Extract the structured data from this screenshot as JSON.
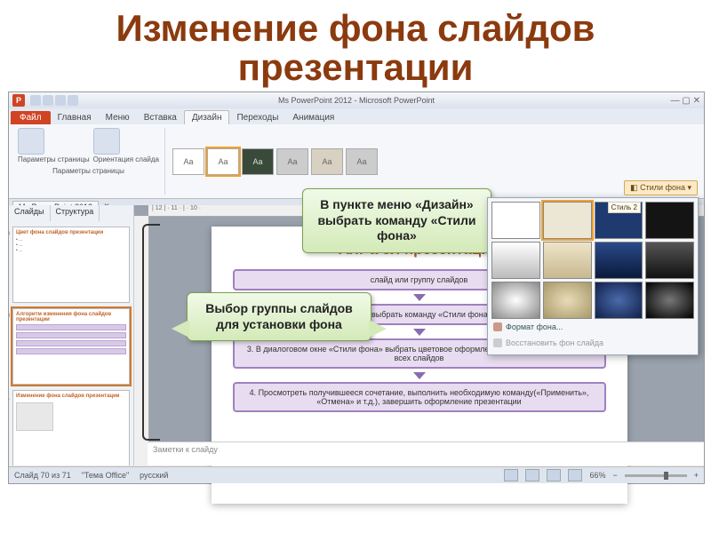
{
  "slide_title": "Изменение фона слайдов презентации",
  "titlebar": {
    "doc": "Ms PowerPoint 2012 - Microsoft PowerPoint"
  },
  "tabs": {
    "file": "Файл",
    "list": [
      "Главная",
      "Меню",
      "Вставка",
      "Дизайн",
      "Переходы",
      "Анимация"
    ],
    "active": "Дизайн"
  },
  "ribbon": {
    "page_setup": "Параметры\nстраницы",
    "orientation": "Ориентация\nслайда",
    "group_label": "Параметры страницы",
    "theme_glyph": "Aa"
  },
  "doc_tab": "Ms PowerPoint 2012",
  "side_tabs": [
    "Слайды",
    "Структура"
  ],
  "thumbs": [
    {
      "num": "69",
      "title": "Цвет фона слайдов презентации"
    },
    {
      "num": "70",
      "title": "Алгоритм изменения фона слайдов презентации"
    },
    {
      "num": "71",
      "title": "Изменение фона слайдов презентации"
    }
  ],
  "ruler": "| 12 | · 11 · | · 10 ·",
  "page": {
    "heading_partial": "Алг                                    а сл         презентации",
    "step1": "слайд или группу слайдов",
    "step2": "Дизайн» выбрать команду «Стили фона…»",
    "step3": "3. В диалоговом окне «Стили фона» выбрать цветовое оформление фона выделенного или всех слайдов",
    "step4": "4. Просмотреть получившееся сочетание, выполнить необходимую команду(«Применить», «Отмена» и т.д.), завершить оформление презентации"
  },
  "callouts": {
    "c1": "В пункте меню «Дизайн» выбрать команду «Стили фона»",
    "c2": "Выбор группы слайдов для установки фона"
  },
  "bgpop": {
    "button": "Стили фона",
    "tooltip": "Стиль 2",
    "format": "Формат фона...",
    "reset": "Восстановить фон слайда",
    "swatches": [
      "#ffffff",
      "#ece6d4",
      "#1e3a6e",
      "#141414",
      "linear-gradient(#fff,#bbb)",
      "linear-gradient(#eee4c8,#c8b890)",
      "linear-gradient(#2a4a8a,#0a1a3a)",
      "linear-gradient(#555,#111)",
      "radial-gradient(#fff,#888)",
      "radial-gradient(#e8dcb8,#a89868)",
      "radial-gradient(#4a6aaa,#10204a)",
      "radial-gradient(#777,#000)"
    ]
  },
  "notes": "Заметки к слайду",
  "status": {
    "slide": "Слайд 70 из 71",
    "theme": "\"Тема Office\"",
    "lang": "русский",
    "zoom": "66%"
  }
}
